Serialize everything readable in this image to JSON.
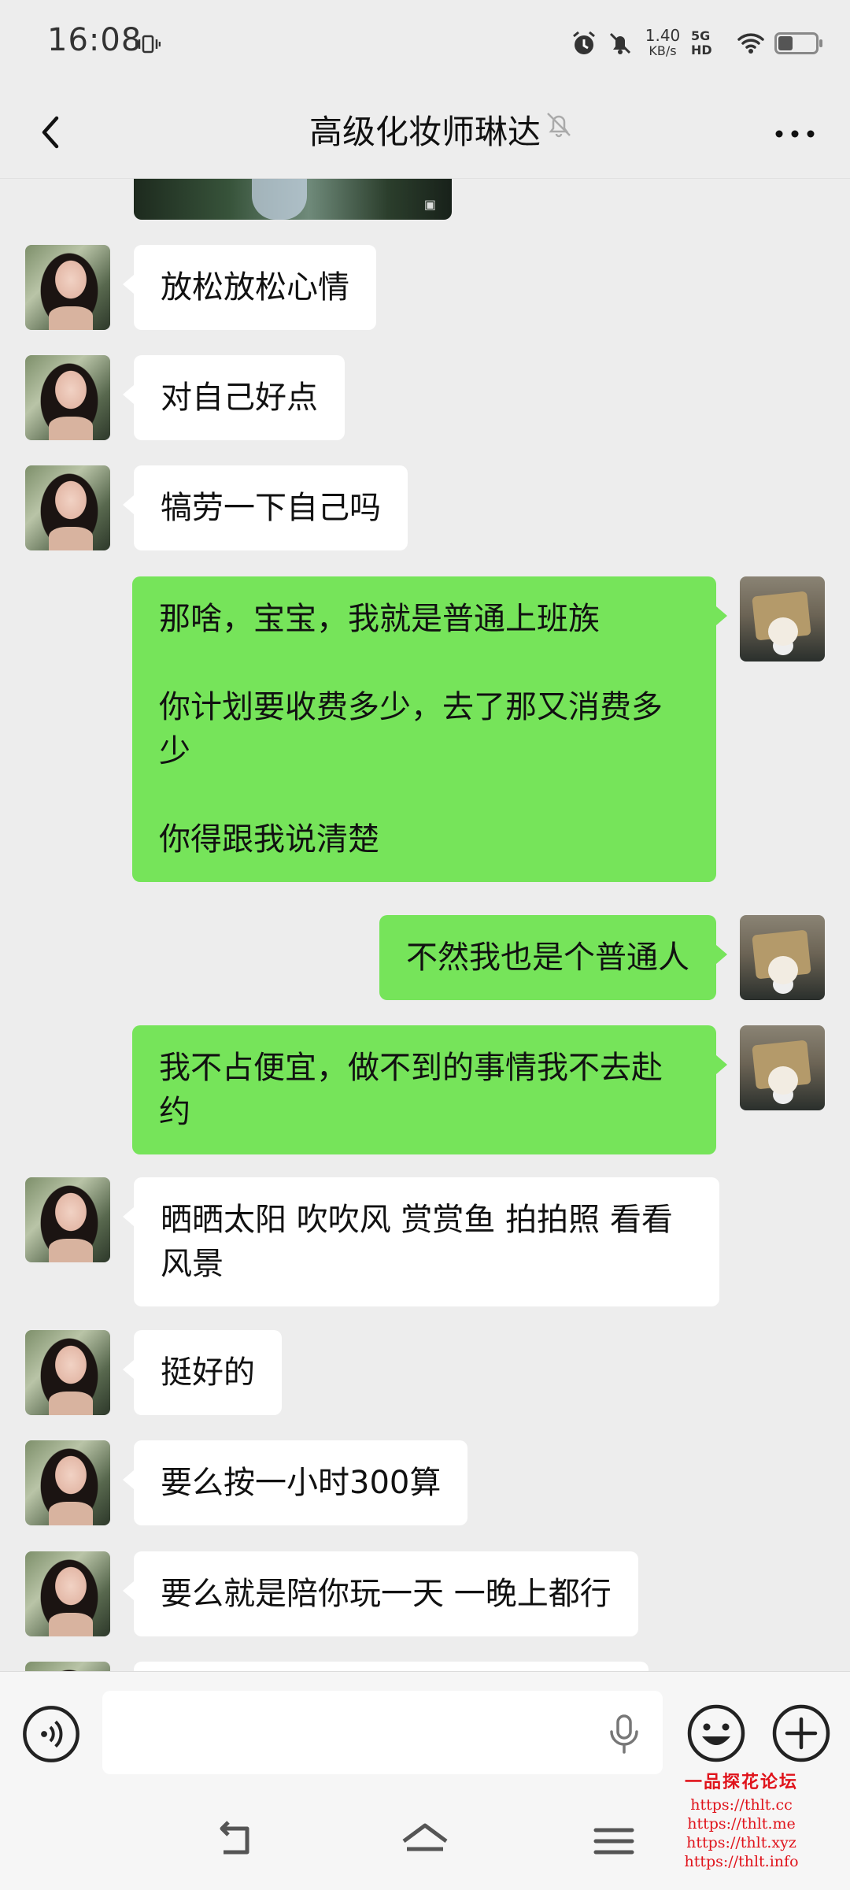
{
  "status_bar": {
    "time": "16:08",
    "net_speed_value": "1.40",
    "net_speed_unit": "KB/s",
    "net_type": "5G HD"
  },
  "header": {
    "title": "高级化妆师琳达"
  },
  "messages": [
    {
      "side": "in",
      "text": "放松放松心情"
    },
    {
      "side": "in",
      "text": "对自己好点"
    },
    {
      "side": "in",
      "text": "犒劳一下自己吗"
    },
    {
      "side": "out",
      "text": "那啥，宝宝，我就是普通上班族\n\n你计划要收费多少，去了那又消费多少\n\n你得跟我说清楚"
    },
    {
      "side": "out",
      "text": "不然我也是个普通人"
    },
    {
      "side": "out",
      "text": "我不占便宜，做不到的事情我不去赴约"
    },
    {
      "side": "in",
      "text": "晒晒太阳 吹吹风 赏赏鱼 拍拍照 看看风景"
    },
    {
      "side": "in",
      "text": "挺好的"
    },
    {
      "side": "in",
      "text": "要么按一小时300算"
    },
    {
      "side": "in",
      "text": "要么就是陪你玩一天 一晚上都行"
    }
  ],
  "watermark": {
    "title": "一品探花论坛",
    "links": [
      "https://thlt.cc",
      "https://thlt.me",
      "https://thlt.xyz",
      "https://thlt.info"
    ]
  },
  "colors": {
    "background": "#ededed",
    "bubble_out": "#76e45a",
    "bubble_in": "#ffffff",
    "watermark": "#e0131b"
  },
  "icons": {
    "back": "chevron-left-icon",
    "mute": "bell-off-icon",
    "more": "more-dots-icon",
    "voice": "voice-icon",
    "mic": "microphone-icon",
    "emoji": "emoji-icon",
    "plus": "plus-icon"
  }
}
